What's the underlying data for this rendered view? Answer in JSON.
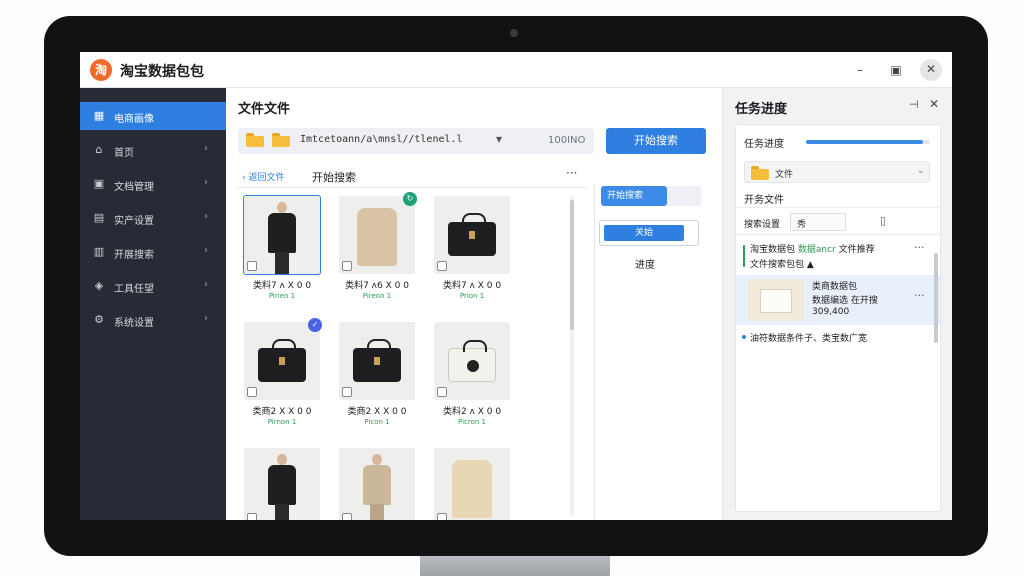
{
  "app": {
    "title": "淘宝数据包包",
    "logo_glyph": "淘"
  },
  "window_controls": {
    "minimize": "–",
    "maximize": "▣",
    "close": "✕"
  },
  "colors": {
    "accent": "#2f7fe0",
    "sidebar_bg": "#262b35",
    "brand": "#f46a2a",
    "success": "#29a053"
  },
  "sidebar": {
    "items": [
      {
        "label": "电商画像",
        "icon": "▦",
        "active": true
      },
      {
        "label": "首页",
        "icon": "⌂",
        "active": false
      },
      {
        "label": "文档管理",
        "icon": "▣",
        "active": false
      },
      {
        "label": "实产设置",
        "icon": "▤",
        "active": false
      },
      {
        "label": "开展搜索",
        "icon": "▥",
        "active": false
      },
      {
        "label": "工具任望",
        "icon": "◈",
        "active": false
      },
      {
        "label": "系统设置",
        "icon": "⚙",
        "active": false
      }
    ],
    "chevron": "›"
  },
  "main": {
    "title": "文件文件",
    "path": "Imtcetoann/a\\mnsl//tlenel.l",
    "path_caret": "▾",
    "count": "100INO",
    "search_button": "开始搜索",
    "back_link": "‹ 返回文件",
    "section_title": "开始搜索",
    "more": "···",
    "products": [
      {
        "caption": "类料7 ʌ X 0 0",
        "sub": "Pirien 1",
        "kind": "person-dark",
        "selected": true,
        "badge": ""
      },
      {
        "caption": "类料7 ʌ6 X 0 0",
        "sub": "Pireon 1",
        "kind": "coat-beige",
        "selected": false,
        "badge": "↻"
      },
      {
        "caption": "类料7 ʌ X 0 0",
        "sub": "Prion 1",
        "kind": "bag-black",
        "selected": false,
        "badge": ""
      },
      {
        "caption": "类商2 X X 0 0",
        "sub": "Pirnon 1",
        "kind": "bag-black",
        "selected": false,
        "badge": "✓"
      },
      {
        "caption": "类商2 X X 0 0",
        "sub": "Picon 1",
        "kind": "bag-tote",
        "selected": false,
        "badge": ""
      },
      {
        "caption": "类料2 ʌ X 0 0",
        "sub": "Picron 1",
        "kind": "bag-white",
        "selected": false,
        "badge": ""
      },
      {
        "caption": "",
        "sub": "",
        "kind": "person-dark",
        "selected": false,
        "badge": ""
      },
      {
        "caption": "",
        "sub": "",
        "kind": "coat-beige",
        "selected": false,
        "badge": ""
      },
      {
        "caption": "",
        "sub": "",
        "kind": "shirt-cream",
        "selected": false,
        "badge": ""
      }
    ],
    "controls": {
      "start_label": "开始搜索",
      "start_progress": 0.66,
      "run_button": "关始",
      "progress_label": "进度"
    }
  },
  "right": {
    "title": "任务进度",
    "pin": "⊣",
    "close": "✕",
    "progress_label": "任务进度",
    "progress_value": 0.94,
    "folder_select": "文件",
    "section": "开务文件",
    "filter_label": "搜索设置",
    "filter_value": "秀",
    "list": [
      {
        "text": "淘宝数据包",
        "green": "数据ancr",
        "tail": "文件推荐",
        "line2": "文件搜索包包 ▲"
      },
      {
        "text": "类商数据包",
        "line2": "数据编选  在开搜",
        "line3": "309,400"
      },
      {
        "text": "油符数据条件子、类宝数广宽"
      }
    ]
  }
}
